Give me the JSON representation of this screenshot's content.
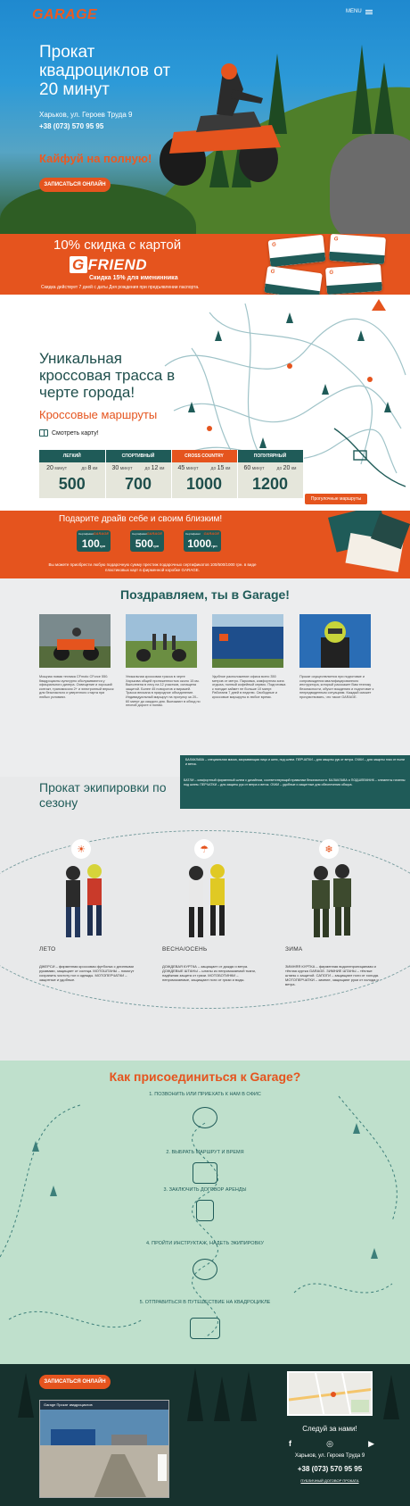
{
  "header": {
    "logo": "GARAGE",
    "menu_label": "MENU"
  },
  "hero": {
    "title": "Прокат квадроциклов от 20 минут",
    "address": "Харьков, ул. Героев Труда 9",
    "phone": "+38 (073) 570 95 95",
    "slogan": "Кайфуй на полную!",
    "cta": "ЗАПИСАТЬСЯ ОНЛАЙН"
  },
  "discount": {
    "title": "10% скидка с картой",
    "brand_g": "G",
    "brand": "FRIEND",
    "subtitle": "Скидка 15% для именинника",
    "note": "Скидка действует 7 дней с даты Дня рождения при предъявлении паспорта."
  },
  "track": {
    "title": "Уникальная кроссовая трасса в черте города!",
    "subtitle": "Кроссовые маршруты",
    "map_link": "Смотреть карту!",
    "routes_button": "Прогулочные маршруты",
    "routes": [
      {
        "name": "ЛЕГКИЙ",
        "t1": "20",
        "t2": "8",
        "price": "500"
      },
      {
        "name": "СПОРТИВНЫЙ",
        "t1": "30",
        "t2": "12",
        "price": "700"
      },
      {
        "name": "CROSS COUNTRY",
        "t1": "45",
        "t2": "15",
        "price": "1000"
      },
      {
        "name": "ПОПУЛЯРНЫЙ",
        "t1": "60",
        "t2": "20",
        "price": "1200"
      }
    ],
    "unit_min": "минут",
    "unit_km": "км",
    "prefix_to": "до"
  },
  "gift": {
    "title": "Подарите драйв себе и своим близким!",
    "cards": [
      {
        "amount": "100",
        "label": "Сертификат"
      },
      {
        "amount": "500",
        "label": "Сертификат"
      },
      {
        "amount": "1000",
        "label": "Сертификат"
      }
    ],
    "currency": "грн",
    "logo": "GARAGE",
    "note": "Вы можете приобрести любую подарочную сумму престиж подарочных сертификатов 100/500/1000 грн. в виде пластиковых карт в фирменной коробке GARAGE."
  },
  "congrats": {
    "title": "Поздравляем, ты в Garage!",
    "columns": [
      "Мощная новая техника CFmoto CForce 550. Квадроциклы культурно обслуживаются у официального дилера. Освещение и хороший контакт, трансмиссия 2+ и электронный впрыск для безопасного и уверенного старта при любых условиях.",
      "Уникальная кроссовая трасса в черте Харькова общей протяженностью около 15 км. Выполнена в лесу на 12 участков, оснащена защитой. Более 45 поворотов и виражей. Трасса вписана в природное объединение. Индивидуальный маршрут на прогулку за 20–60 минут до каждого дня. Выезжают в обход по лесной дороге и полям.",
      "Удобное расположение офиса всего 350 метров от метро. Парковка, комфортная зона отдыха, полный кофейный сервис. Подготовка к поездке займет не больше 10 минут. Работаем 7 дней в неделю. Свободные и кроссовые маршруты в любое время.",
      "Прокат осуществляется при подготовке и сопровождении квалифицированного инструктора, который расскажет Вам технику безопасности, обучит вождению и подготовит к непредвиденным ситуациям. Каждый сможет прочувствовать, что такое GARAGE."
    ],
    "info": "БАЛАКЛАВА – специальная маска, закрывающая лицо и шею, под шлем. ПЕРЧАТКИ – для защиты рук от ветра. ОЧКИ – для защиты глаз от пыли и веток."
  },
  "equipment": {
    "title": "Прокат экипировки по сезону",
    "info": "БАТЛИ – комфортный фирменный шлем с дизайном, соответствующий правилам безопасности. БАЛАКЛАВА и ПОДШЛЕМНИК – элементы гигиены под шлем. ПЕРЧАТКИ – для защиты рук от ветра и веток. ОЧКИ – удобные и защитные для обеспечения обзора.",
    "seasons": [
      {
        "name": "ЛЕТО",
        "text": "ДЖЕРСИ – фирменная кроссовая футболка с длинными рукавами, защищает от солнца. МОТОШТАНЫ – помогут сохранить чистоту ног и одежды. МОТОПЕРЧАТКИ – защитные и удобные."
      },
      {
        "name": "ВЕСНА/ОСЕНЬ",
        "text": "ДОЖДЕВАЯ КУРТКА – защищает от дождя и ветра. ДОЖДЕВЫЕ ШТАНЫ – штаны из непромокаемой ткани, надёжная защита от грязи. МОТОБОТИНКИ – непромокаемые, защищают ноги от грязи и воды."
      },
      {
        "name": "ЗИМА",
        "text": "ЗИМНЯЯ КУРТКА – фирменная водонепроницаемая и тёплая куртка GARAGE. ЗИМНИЕ ШТАНЫ – тёплые штаны с защитой. САПОГИ – защищают ноги от холода. МОТОПЕРЧАТКИ – зимние, защищают руки от холода и ветра."
      }
    ]
  },
  "join": {
    "title": "Как присоединиться к Garage?",
    "steps": [
      "1. ПОЗВОНИТЬ ИЛИ ПРИЕХАТЬ К НАМ В ОФИС",
      "2. ВЫБРАТЬ МАРШРУТ И ВРЕМЯ",
      "3. ЗАКЛЮЧИТЬ ДОГОВОР АРЕНДЫ",
      "4. ПРОЙТИ ИНСТРУКТАЖ, НАДЕТЬ ЭКИПИРОВКУ",
      "5. ОТПРАВИТЬСЯ В ПУТЕШЕСТВИЕ НА КВАДРОЦИКЛЕ"
    ]
  },
  "footer": {
    "cta": "ЗАПИСАТЬСЯ ОНЛАЙН",
    "follow": "Следуй за нами!",
    "socials": [
      "f",
      "◎",
      "▶"
    ],
    "address": "Харьков, ул. Героев Труда 9",
    "phone": "+38 (073) 570 95 95",
    "offer_link": "ПУБЛИЧНЫЙ ДОГОВОР ПРОКАТА",
    "video_title": "Garage Прокат квадроциклов"
  },
  "colors": {
    "accent": "#e5541e",
    "teal": "#1f5b58",
    "mint": "#bfe0cc"
  }
}
